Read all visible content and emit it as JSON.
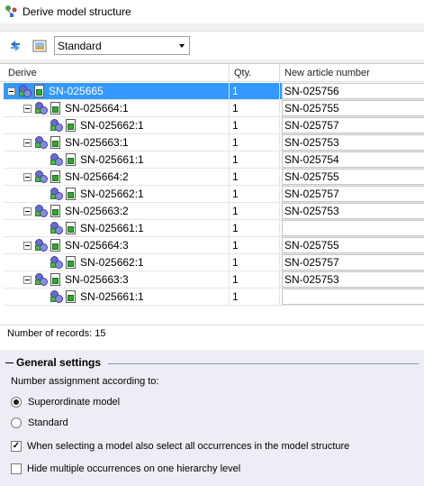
{
  "window": {
    "title": "Derive model structure"
  },
  "toolbar": {
    "view_select": "Standard"
  },
  "columns": {
    "derive": "Derive",
    "qty": "Qty.",
    "new_article": "New article number"
  },
  "rows": [
    {
      "name": "SN-025665",
      "qty": "1",
      "article": "SN-025756",
      "level": 0,
      "type": "assembly",
      "expandable": true,
      "selected": true
    },
    {
      "name": "SN-025664:1",
      "qty": "1",
      "article": "SN-025755",
      "level": 1,
      "type": "assembly",
      "expandable": true
    },
    {
      "name": "SN-025662:1",
      "qty": "1",
      "article": "SN-025757",
      "level": 2,
      "type": "assembly",
      "expandable": false
    },
    {
      "name": "SN-025663:1",
      "qty": "1",
      "article": "SN-025753",
      "level": 1,
      "type": "assembly",
      "expandable": true
    },
    {
      "name": "SN-025661:1",
      "qty": "1",
      "article": "SN-025754",
      "level": 2,
      "type": "assembly",
      "expandable": false
    },
    {
      "name": "SN-025664:2",
      "qty": "1",
      "article": "SN-025755",
      "level": 1,
      "type": "assembly",
      "expandable": true
    },
    {
      "name": "SN-025662:1",
      "qty": "1",
      "article": "SN-025757",
      "level": 2,
      "type": "assembly",
      "expandable": false
    },
    {
      "name": "SN-025663:2",
      "qty": "1",
      "article": "SN-025753",
      "level": 1,
      "type": "assembly",
      "expandable": true
    },
    {
      "name": "SN-025661:1",
      "qty": "1",
      "article": "",
      "level": 2,
      "type": "assembly",
      "expandable": false
    },
    {
      "name": "SN-025664:3",
      "qty": "1",
      "article": "SN-025755",
      "level": 1,
      "type": "assembly",
      "expandable": true
    },
    {
      "name": "SN-025662:1",
      "qty": "1",
      "article": "SN-025757",
      "level": 2,
      "type": "assembly",
      "expandable": false
    },
    {
      "name": "SN-025663:3",
      "qty": "1",
      "article": "SN-025753",
      "level": 1,
      "type": "assembly",
      "expandable": true
    },
    {
      "name": "SN-025661:1",
      "qty": "1",
      "article": "",
      "level": 2,
      "type": "assembly",
      "expandable": false
    }
  ],
  "status": {
    "records": "Number of records: 15"
  },
  "settings": {
    "header": "General settings",
    "assignment_label": "Number assignment according to:",
    "radio_superordinate": "Superordinate model",
    "radio_standard": "Standard",
    "selected_radio": "Superordinate model",
    "check_select_all": "When selecting a model also select all occurrences in the model structure",
    "check_select_all_checked": true,
    "check_hide_multiple": "Hide multiple occurrences on one hierarchy level",
    "check_hide_multiple_checked": false
  },
  "colors": {
    "selection": "#3399ff",
    "settings_bg": "#edeef5"
  },
  "icons": {
    "app": "derive-structure-icon",
    "refresh": "refresh-icon",
    "image": "preview-icon",
    "assembly": "assembly-icon",
    "part": "part-icon"
  }
}
